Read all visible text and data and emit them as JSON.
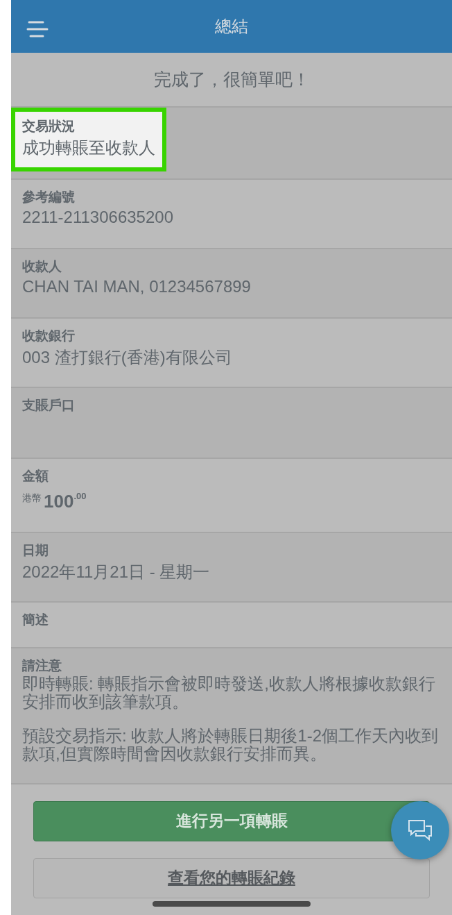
{
  "header": {
    "title": "總結"
  },
  "subtitle": "完成了，很簡單吧！",
  "rows": [
    {
      "kind": "text",
      "label": "交易狀況",
      "value": "成功轉賬至收款人",
      "highlighted": true
    },
    {
      "kind": "text",
      "label": "參考編號",
      "value": "2211-211306635200",
      "highlighted": false
    },
    {
      "kind": "text",
      "label": "收款人",
      "value": "CHAN TAI MAN, 01234567899",
      "highlighted": false
    },
    {
      "kind": "text",
      "label": "收款銀行",
      "value": "003 渣打銀行(香港)有限公司",
      "highlighted": false
    },
    {
      "kind": "empty",
      "label": "支賬戶口",
      "highlighted": false
    },
    {
      "kind": "amount",
      "label": "金額",
      "currency": "港幣",
      "whole": "100",
      "cents": ".00",
      "highlighted": false
    },
    {
      "kind": "text",
      "label": "日期",
      "value": "2022年11月21日 - 星期一",
      "highlighted": false
    },
    {
      "kind": "label",
      "label": "簡述",
      "highlighted": false
    },
    {
      "kind": "notes",
      "label": "請注意",
      "paragraphs": [
        "即時轉賬: 轉賬指示會被即時發送,收款人將根據收款銀行安排而收到該筆款項。",
        "預設交易指示: 收款人將於轉賬日期後1-2個工作天內收到款項,但實際時間會因收款銀行安排而異。"
      ],
      "highlighted": false
    }
  ],
  "buttons": [
    {
      "kind": "primary",
      "label": "進行另一項轉賬"
    },
    {
      "kind": "secondary",
      "label": "查看您的轉賬紀錄"
    }
  ]
}
